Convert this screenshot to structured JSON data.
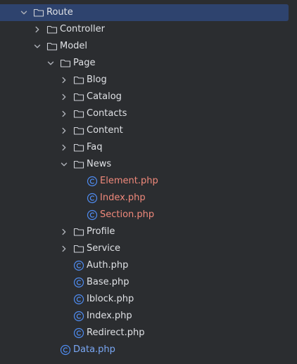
{
  "colors": {
    "background": "#2b2d30",
    "selection": "#2e436e",
    "text": "#dfe1e5",
    "modified": "#f0897b",
    "added": "#7aa8f5",
    "php_class_icon": "#4f8cf1",
    "folder_icon": "#ced0d6"
  },
  "tree": [
    {
      "label": "Route",
      "depth": 1,
      "type": "folder",
      "expanded": true,
      "selected": true
    },
    {
      "label": "Controller",
      "depth": 2,
      "type": "folder",
      "expanded": false
    },
    {
      "label": "Model",
      "depth": 2,
      "type": "folder",
      "expanded": true
    },
    {
      "label": "Page",
      "depth": 3,
      "type": "folder",
      "expanded": true
    },
    {
      "label": "Blog",
      "depth": 4,
      "type": "folder",
      "expanded": false
    },
    {
      "label": "Catalog",
      "depth": 4,
      "type": "folder",
      "expanded": false
    },
    {
      "label": "Contacts",
      "depth": 4,
      "type": "folder",
      "expanded": false
    },
    {
      "label": "Content",
      "depth": 4,
      "type": "folder",
      "expanded": false
    },
    {
      "label": "Faq",
      "depth": 4,
      "type": "folder",
      "expanded": false
    },
    {
      "label": "News",
      "depth": 4,
      "type": "folder",
      "expanded": true
    },
    {
      "label": "Element.php",
      "depth": 5,
      "type": "php",
      "status": "modified"
    },
    {
      "label": "Index.php",
      "depth": 5,
      "type": "php",
      "status": "modified"
    },
    {
      "label": "Section.php",
      "depth": 5,
      "type": "php",
      "status": "modified"
    },
    {
      "label": "Profile",
      "depth": 4,
      "type": "folder",
      "expanded": false
    },
    {
      "label": "Service",
      "depth": 4,
      "type": "folder",
      "expanded": false
    },
    {
      "label": "Auth.php",
      "depth": 4,
      "type": "php",
      "status": "normal"
    },
    {
      "label": "Base.php",
      "depth": 4,
      "type": "php",
      "status": "normal"
    },
    {
      "label": "Iblock.php",
      "depth": 4,
      "type": "php",
      "status": "normal"
    },
    {
      "label": "Index.php",
      "depth": 4,
      "type": "php",
      "status": "normal"
    },
    {
      "label": "Redirect.php",
      "depth": 4,
      "type": "php",
      "status": "normal"
    },
    {
      "label": "Data.php",
      "depth": 3,
      "type": "php",
      "status": "added"
    }
  ]
}
